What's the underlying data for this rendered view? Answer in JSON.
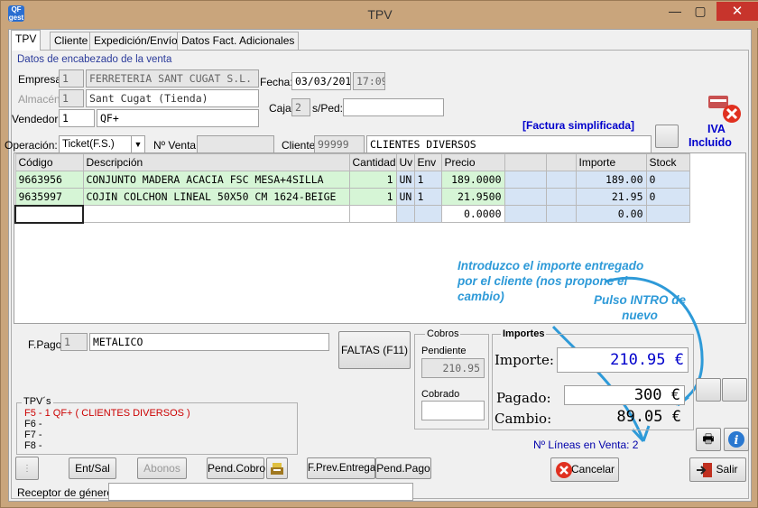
{
  "window": {
    "title": "TPV",
    "app_icon": "QF gest",
    "minimize": "—",
    "maximize": "▢",
    "close": "✕"
  },
  "tabs": [
    "TPV",
    "Cliente",
    "Expedición/Envío",
    "Datos Fact. Adicionales"
  ],
  "header": {
    "section_title": "Datos de encabezado de la venta",
    "empresa_label": "Empresa:",
    "empresa_code": "1",
    "empresa_name": "FERRETERIA SANT CUGAT S.L.",
    "almacen_label": "Almacén:",
    "almacen_code": "1",
    "almacen_name": "Sant Cugat (Tienda)",
    "vendedor_label": "Vendedor:",
    "vendedor_code": "1",
    "vendedor_name": "QF+",
    "fecha_label": "Fecha:",
    "fecha": "03/03/2015",
    "hora": "17:09",
    "caja_label": "Caja:",
    "caja": "2",
    "sped_label": "s/Ped:",
    "sped": "",
    "operacion_label": "Operación:",
    "operacion": "Ticket(F.S.)",
    "nventa_label": "Nº Venta:",
    "nventa": "",
    "cliente_label": "Cliente:",
    "cliente_code": "99999",
    "cliente_name": "CLIENTES DIVERSOS",
    "factura": "[Factura simplificada]",
    "iva_line1": "IVA",
    "iva_line2": "Incluido"
  },
  "table": {
    "headers": [
      "Código",
      "Descripción",
      "Cantidad",
      "Uv",
      "Env",
      "Precio",
      "",
      "",
      "Importe",
      "Stock"
    ],
    "rows": [
      [
        "9663956",
        "CONJUNTO MADERA ACACIA FSC MESA+4SILLA",
        "1",
        "UN",
        "1",
        "189.0000",
        "",
        "",
        "189.00",
        "0"
      ],
      [
        "9635997",
        "COJIN COLCHON LINEAL 50X50 CM 1624-BEIGE",
        "1",
        "UN",
        "1",
        "21.9500",
        "",
        "",
        "21.95",
        "0"
      ],
      [
        "",
        "",
        "",
        "",
        "",
        "0.0000",
        "",
        "",
        "0.00",
        ""
      ]
    ]
  },
  "annotations": {
    "a1": "Introduzco el importe entregado por el cliente (nos propone el cambio)",
    "a2": "Pulso INTRO de nuevo"
  },
  "payment": {
    "fpago_label": "F.Pago",
    "fpago_code": "1",
    "fpago_name": "METALICO",
    "faltas_button": "FALTAS (F11)"
  },
  "cobros": {
    "title": "Cobros",
    "pendiente_label": "Pendiente",
    "pendiente": "210.95",
    "cobrado_label": "Cobrado",
    "cobrado": ""
  },
  "importes": {
    "title": "Importes",
    "importe_label": "Importe:",
    "importe": "210.95 €",
    "pagado_label": "Pagado:",
    "pagado": "300 €",
    "cambio_label": "Cambio:",
    "cambio": "89.05 €",
    "lineas": "Nº Líneas en Venta: 2"
  },
  "tpvs": {
    "title": "TPV´s",
    "lines": [
      "F5 - 1 QF+ ( CLIENTES DIVERSOS )",
      "F6 -",
      "F7 -",
      "F8 -"
    ]
  },
  "buttons": {
    "entsal": "Ent/Sal",
    "abonos": "Abonos",
    "pendcobro": "Pend.Cobro",
    "prev": "F.Prev.Entrega",
    "pendpago": "Pend.Pago",
    "cancelar": "Cancelar",
    "salir": "Salir"
  },
  "receptor_label": "Receptor de género",
  "receptor": "",
  "colors": {
    "accent_blue": "#0000cc",
    "annotation": "#2e9ad8",
    "row_green": "#d6f5d6",
    "tpv_red": "#cc0000"
  }
}
